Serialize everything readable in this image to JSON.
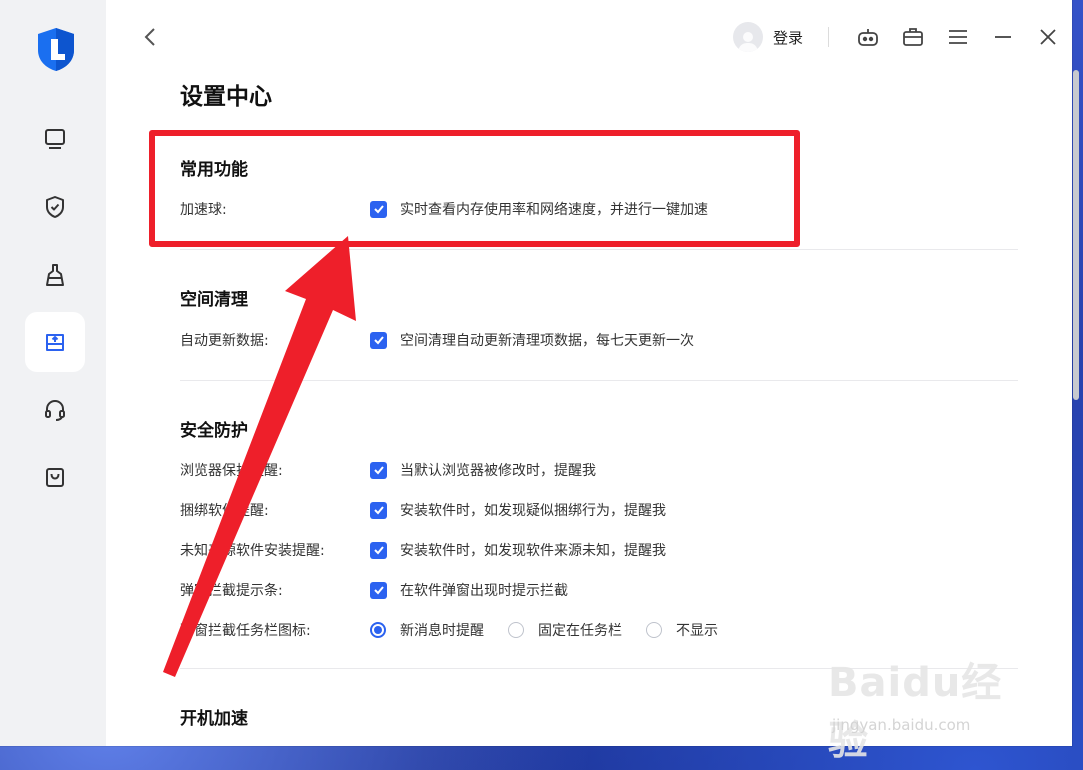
{
  "header": {
    "login_label": "登录"
  },
  "page": {
    "title": "设置中心"
  },
  "sections": [
    {
      "title": "常用功能",
      "rows": [
        {
          "label": "加速球:",
          "text": "实时查看内存使用率和网络速度，并进行一键加速",
          "checked": true
        }
      ]
    },
    {
      "title": "空间清理",
      "rows": [
        {
          "label": "自动更新数据:",
          "text": "空间清理自动更新清理项数据，每七天更新一次",
          "checked": true
        }
      ]
    },
    {
      "title": "安全防护",
      "rows": [
        {
          "label": "浏览器保护提醒:",
          "text": "当默认浏览器被修改时，提醒我",
          "checked": true
        },
        {
          "label": "捆绑软件提醒:",
          "text": "安装软件时，如发现疑似捆绑行为，提醒我",
          "checked": true
        },
        {
          "label": "未知来源软件安装提醒:",
          "text": "安装软件时，如发现软件来源未知，提醒我",
          "checked": true
        },
        {
          "label": "弹窗拦截提示条:",
          "text": "在软件弹窗出现时提示拦截",
          "checked": true
        },
        {
          "label": "弹窗拦截任务栏图标:",
          "options": [
            "新消息时提醒",
            "固定在任务栏",
            "不显示"
          ],
          "selected": "新消息时提醒"
        }
      ]
    },
    {
      "title": "开机加速",
      "rows": []
    }
  ],
  "colors": {
    "accent": "#2b62f0",
    "annotation_red": "#ee1f2a",
    "sidebar_bg": "#f1f2f4"
  },
  "icons": {
    "sidebar": [
      "computer-icon",
      "shield-check-icon",
      "cleaning-brush-icon",
      "disk-icon",
      "headset-icon",
      "shopping-bag-icon"
    ],
    "toolbar": [
      "robot-icon",
      "toolbox-icon",
      "menu-icon",
      "minimize-icon",
      "close-icon"
    ]
  },
  "watermark": {
    "brand": "Baidu经验",
    "url": "jingyan.baidu.com"
  }
}
